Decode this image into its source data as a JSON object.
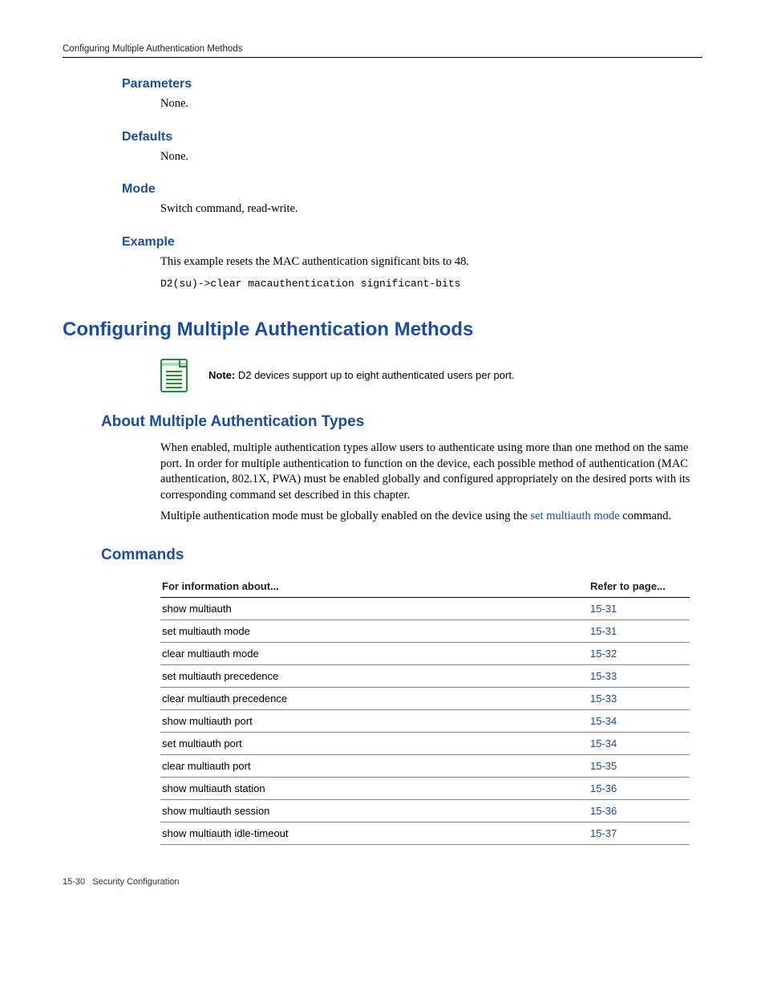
{
  "header": {
    "running_title": "Configuring Multiple Authentication Methods"
  },
  "sections": {
    "parameters": {
      "heading": "Parameters",
      "body": "None."
    },
    "defaults": {
      "heading": "Defaults",
      "body": "None."
    },
    "mode": {
      "heading": "Mode",
      "body": "Switch command, read-write."
    },
    "example": {
      "heading": "Example",
      "body": "This example resets the MAC authentication significant bits to 48.",
      "code": "D2(su)->clear macauthentication significant-bits"
    }
  },
  "h1": "Configuring Multiple Authentication Methods",
  "note": {
    "label": "Note:",
    "text": "D2 devices support up to eight authenticated users per port."
  },
  "about": {
    "heading": "About Multiple Authentication Types",
    "p1": "When enabled, multiple authentication types allow users to authenticate using more than one method on the same port. In order for multiple authentication to function on the device, each possible method of authentication (MAC authentication, 802.1X, PWA) must be enabled globally and configured appropriately on the desired ports with its corresponding command set described in this chapter.",
    "p2_pre": "Multiple authentication mode must be globally enabled on the device using the ",
    "p2_link": "set multiauth mode",
    "p2_post": " command."
  },
  "commands": {
    "heading": "Commands",
    "col_info": "For information about...",
    "col_page": "Refer to page...",
    "rows": [
      {
        "name": "show multiauth",
        "page": "15-31"
      },
      {
        "name": "set multiauth mode",
        "page": "15-31"
      },
      {
        "name": "clear multiauth mode",
        "page": "15-32"
      },
      {
        "name": "set multiauth precedence",
        "page": "15-33"
      },
      {
        "name": "clear multiauth precedence",
        "page": "15-33"
      },
      {
        "name": "show multiauth port",
        "page": "15-34"
      },
      {
        "name": "set multiauth port",
        "page": "15-34"
      },
      {
        "name": "clear multiauth port",
        "page": "15-35"
      },
      {
        "name": "show multiauth station",
        "page": "15-36"
      },
      {
        "name": "show multiauth session",
        "page": "15-36"
      },
      {
        "name": "show multiauth idle-timeout",
        "page": "15-37"
      }
    ]
  },
  "footer": {
    "page_num": "15-30",
    "chapter": "Security Configuration"
  }
}
